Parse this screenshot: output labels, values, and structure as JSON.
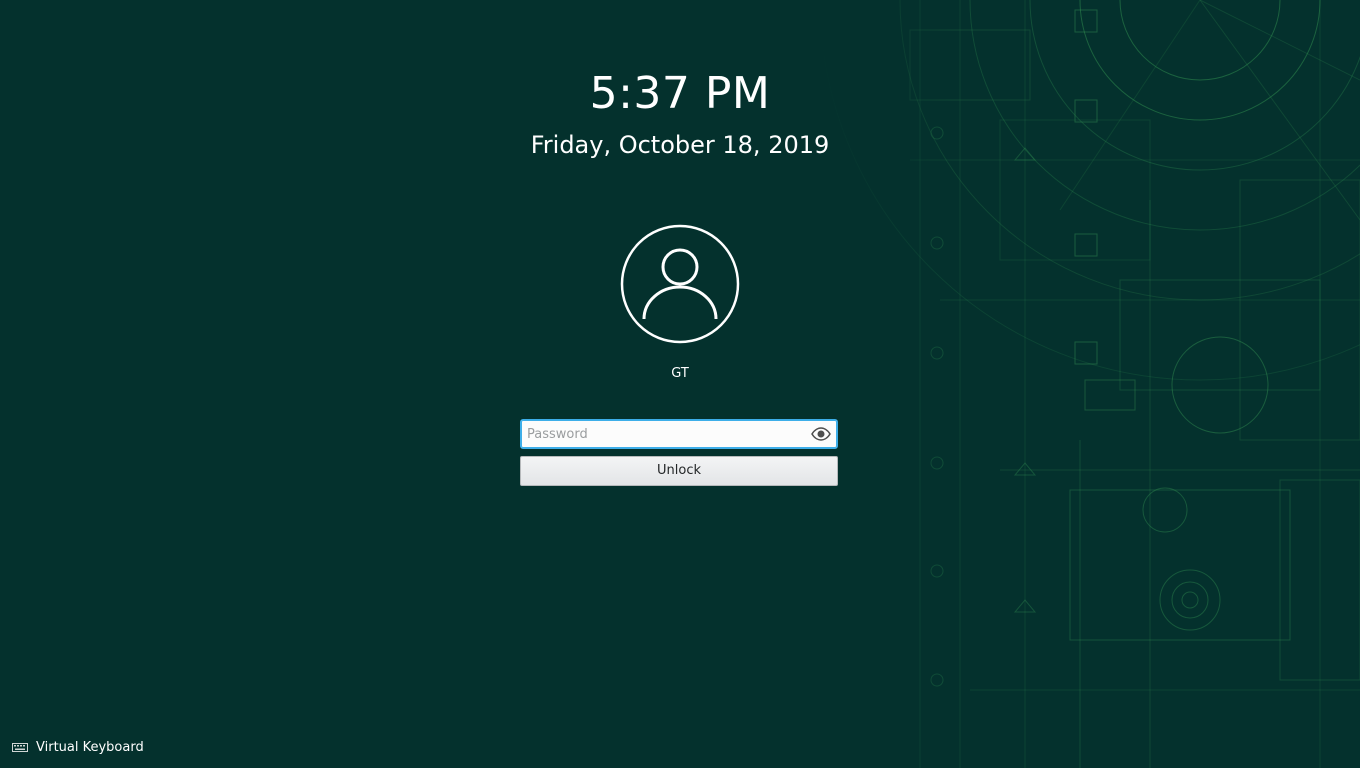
{
  "lockscreen": {
    "time": "5:37 PM",
    "date": "Friday, October 18, 2019",
    "user": {
      "name": "GT",
      "avatar_icon": "user-avatar-icon"
    },
    "password": {
      "placeholder": "Password",
      "value": "",
      "reveal_icon": "eye-icon"
    },
    "unlock_label": "Unlock",
    "virtual_keyboard": {
      "label": "Virtual Keyboard",
      "icon": "keyboard-icon"
    }
  },
  "colors": {
    "background": "#04312d",
    "wallpaper_lines": "#2f8a4f",
    "focus_accent": "#3daee9",
    "text": "#ffffff"
  }
}
